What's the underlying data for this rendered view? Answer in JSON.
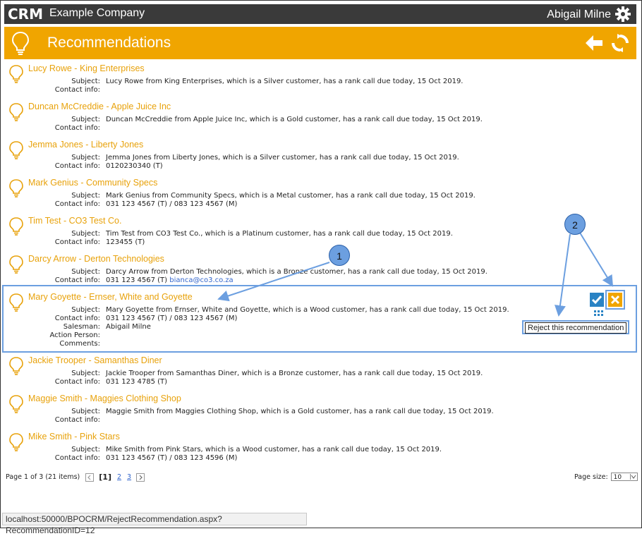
{
  "app": {
    "logo_text": "CRM",
    "company": "Example Company",
    "user": "Abigail Milne"
  },
  "page": {
    "title": "Recommendations"
  },
  "labels": {
    "subject": "Subject:",
    "contact": "Contact info:",
    "salesman": "Salesman:",
    "action_person": "Action Person:",
    "comments": "Comments:"
  },
  "recommendations": [
    {
      "title": "Lucy Rowe - King Enterprises",
      "subject": "Lucy Rowe from King Enterprises, which is a Silver customer, has a rank call due today, 15 Oct 2019.",
      "contact": ""
    },
    {
      "title": "Duncan McCreddie - Apple Juice Inc",
      "subject": "Duncan McCreddie from Apple Juice Inc, which is a Gold customer, has a rank call due today, 15 Oct 2019.",
      "contact": ""
    },
    {
      "title": "Jemma Jones - Liberty Jones",
      "subject": "Jemma Jones from Liberty Jones, which is a Silver customer, has a rank call due today, 15 Oct 2019.",
      "contact": "0120230340 (T)"
    },
    {
      "title": "Mark Genius - Community Specs",
      "subject": "Mark Genius from Community Specs, which is a Metal customer, has a rank call due today, 15 Oct 2019.",
      "contact": "031 123 4567 (T) / 083 123 4567 (M)"
    },
    {
      "title": "Tim Test - CO3 Test Co.",
      "subject": "Tim Test from CO3 Test Co., which is a Platinum customer, has a rank call due today, 15 Oct 2019.",
      "contact": "123455 (T)"
    },
    {
      "title": "Darcy Arrow - Derton Technologies",
      "subject": "Darcy Arrow from Derton Technologies, which is a Bronze customer, has a rank call due today, 15 Oct 2019.",
      "contact": "031 123 4567 (T)",
      "contact_email": "bianca@co3.co.za"
    },
    {
      "title": "Mary Goyette - Ernser, White and Goyette",
      "subject": "Mary Goyette from Ernser, White and Goyette, which is a Wood customer, has a rank call due today, 15 Oct 2019.",
      "contact": "031 123 4567 (T) / 083 123 4567 (M)",
      "salesman": "Abigail Milne",
      "action_person": "",
      "comments": ""
    },
    {
      "title": "Jackie Trooper - Samanthas Diner",
      "subject": "Jackie Trooper from Samanthas Diner, which is a Bronze customer, has a rank call due today, 15 Oct 2019.",
      "contact": "031 123 4785 (T)"
    },
    {
      "title": "Maggie Smith - Maggies Clothing Shop",
      "subject": "Maggie Smith from Maggies Clothing Shop, which is a Gold customer, has a rank call due today, 15 Oct 2019.",
      "contact": ""
    },
    {
      "title": "Mike Smith - Pink Stars",
      "subject": "Mike Smith from Pink Stars, which is a Wood customer, has a rank call due today, 15 Oct 2019.",
      "contact": "031 123 4567 (T) / 083 123 4596 (M)"
    }
  ],
  "tooltip": "Reject this recommendation",
  "callouts": {
    "one": "1",
    "two": "2"
  },
  "pager": {
    "summary": "Page 1 of 3 (21 items)",
    "pages": [
      "[1]",
      "2",
      "3"
    ],
    "page_size_label": "Page size:",
    "page_size": "10"
  },
  "status_url": "localhost:50000/BPOCRM/RejectRecommendation.aspx?RecommendationID=12",
  "colors": {
    "accent": "#f0a500",
    "topbar": "#3a3a3a",
    "annotation": "#6c9fe0",
    "link": "#3366cc"
  }
}
